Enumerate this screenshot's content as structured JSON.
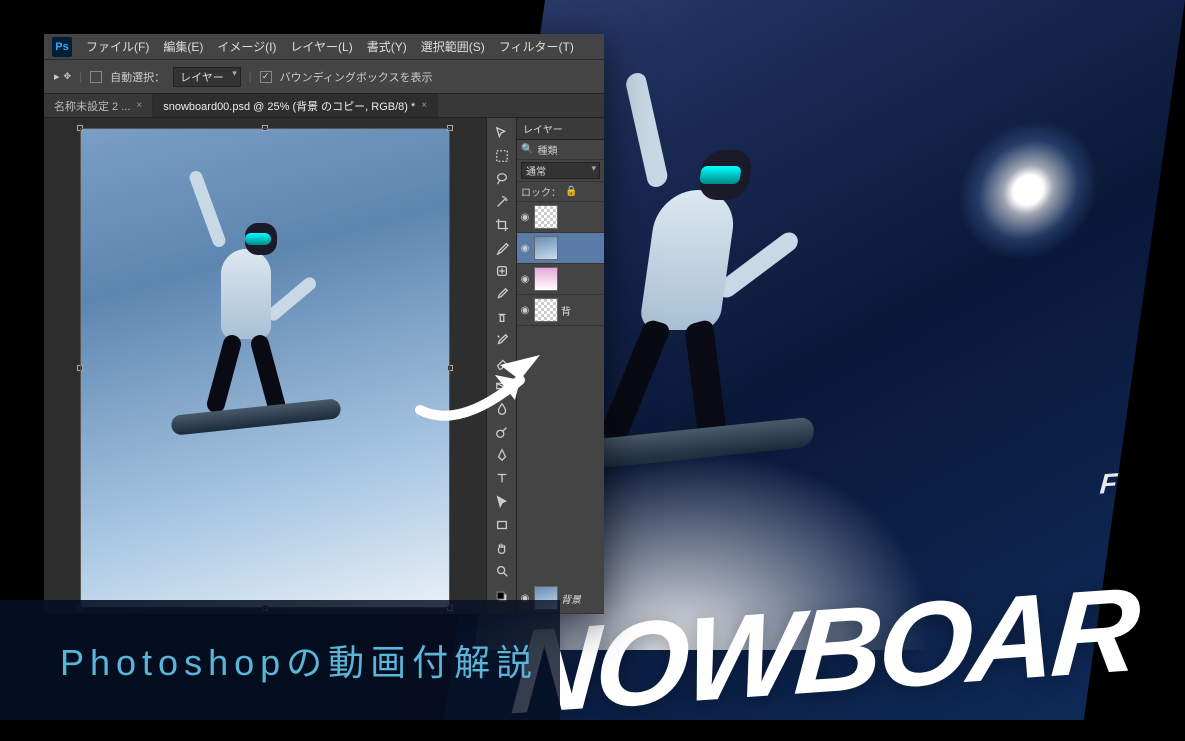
{
  "menu": {
    "items": [
      "ファイル(F)",
      "編集(E)",
      "イメージ(I)",
      "レイヤー(L)",
      "書式(Y)",
      "選択範囲(S)",
      "フィルター(T)"
    ]
  },
  "options": {
    "auto_select_label": "自動選択：",
    "auto_select_target": "レイヤー",
    "bbox_label": "バウンディングボックスを表示"
  },
  "tabs": [
    {
      "label": "名称未設定 2 ...",
      "active": false
    },
    {
      "label": "snowboard00.psd @ 25% (背景 のコピー, RGB/8) *",
      "active": true
    }
  ],
  "tools": [
    "move-tool",
    "marquee-tool",
    "lasso-tool",
    "magic-wand-tool",
    "crop-tool",
    "eyedropper-tool",
    "healing-brush-tool",
    "brush-tool",
    "clone-stamp-tool",
    "history-brush-tool",
    "eraser-tool",
    "gradient-tool",
    "blur-tool",
    "dodge-tool",
    "pen-tool",
    "type-tool",
    "path-select-tool",
    "rectangle-tool",
    "hand-tool",
    "zoom-tool",
    "foreground-background"
  ],
  "layers_panel": {
    "tab": "レイヤー",
    "kind_label": "種類",
    "blend_mode": "通常",
    "lock_label": "ロック：",
    "layers": [
      {
        "thumb": "checker",
        "name": ""
      },
      {
        "thumb": "img",
        "name": "",
        "selected": true
      },
      {
        "thumb": "pink",
        "name": ""
      },
      {
        "thumb": "checker",
        "name": "背"
      },
      {
        "thumb": "img",
        "name": "背景"
      }
    ]
  },
  "poster": {
    "small_text": "F",
    "big_text": "NOWBOAR"
  },
  "caption": "Photoshopの動画付解説",
  "icons": {
    "magnify": "🔍",
    "eye": "👁"
  }
}
